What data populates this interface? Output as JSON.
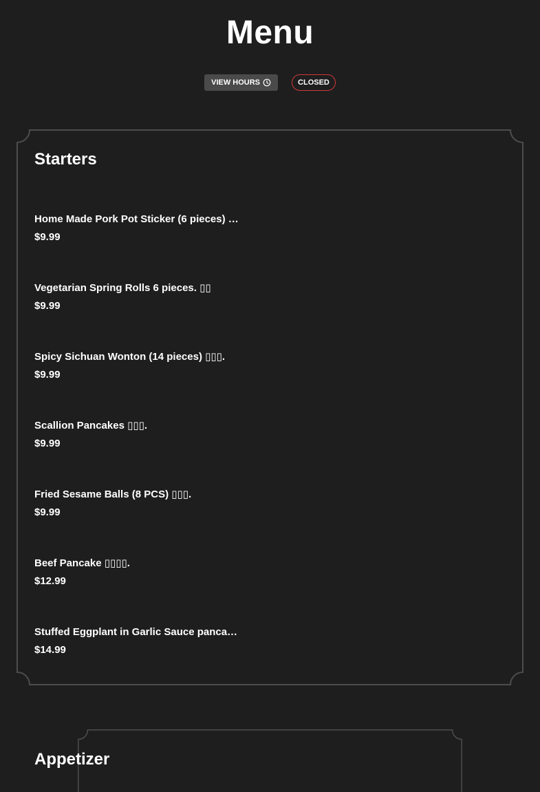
{
  "header": {
    "title": "Menu",
    "hours_button_label": "VIEW HOURS",
    "hours_icon": "clock-icon",
    "status_badge": "CLOSED",
    "status_color": "#d13a3a"
  },
  "sections": [
    {
      "title": "Starters",
      "items": [
        {
          "name": "Home Made Pork Pot Sticker (6 pieces) …",
          "price": "$9.99"
        },
        {
          "name": "Vegetarian Spring Rolls 6 pieces. ▯▯",
          "price": "$9.99"
        },
        {
          "name": "Spicy Sichuan Wonton (14 pieces) ▯▯▯.",
          "price": "$9.99"
        },
        {
          "name": "Scallion Pancakes ▯▯▯.",
          "price": "$9.99"
        },
        {
          "name": "Fried Sesame Balls (8 PCS) ▯▯▯.",
          "price": "$9.99"
        },
        {
          "name": "Beef Pancake ▯▯▯▯.",
          "price": "$12.99"
        },
        {
          "name": "Stuffed Eggplant in Garlic Sauce panca…",
          "price": "$14.99"
        }
      ]
    },
    {
      "title": "Appetizer",
      "items": []
    }
  ]
}
